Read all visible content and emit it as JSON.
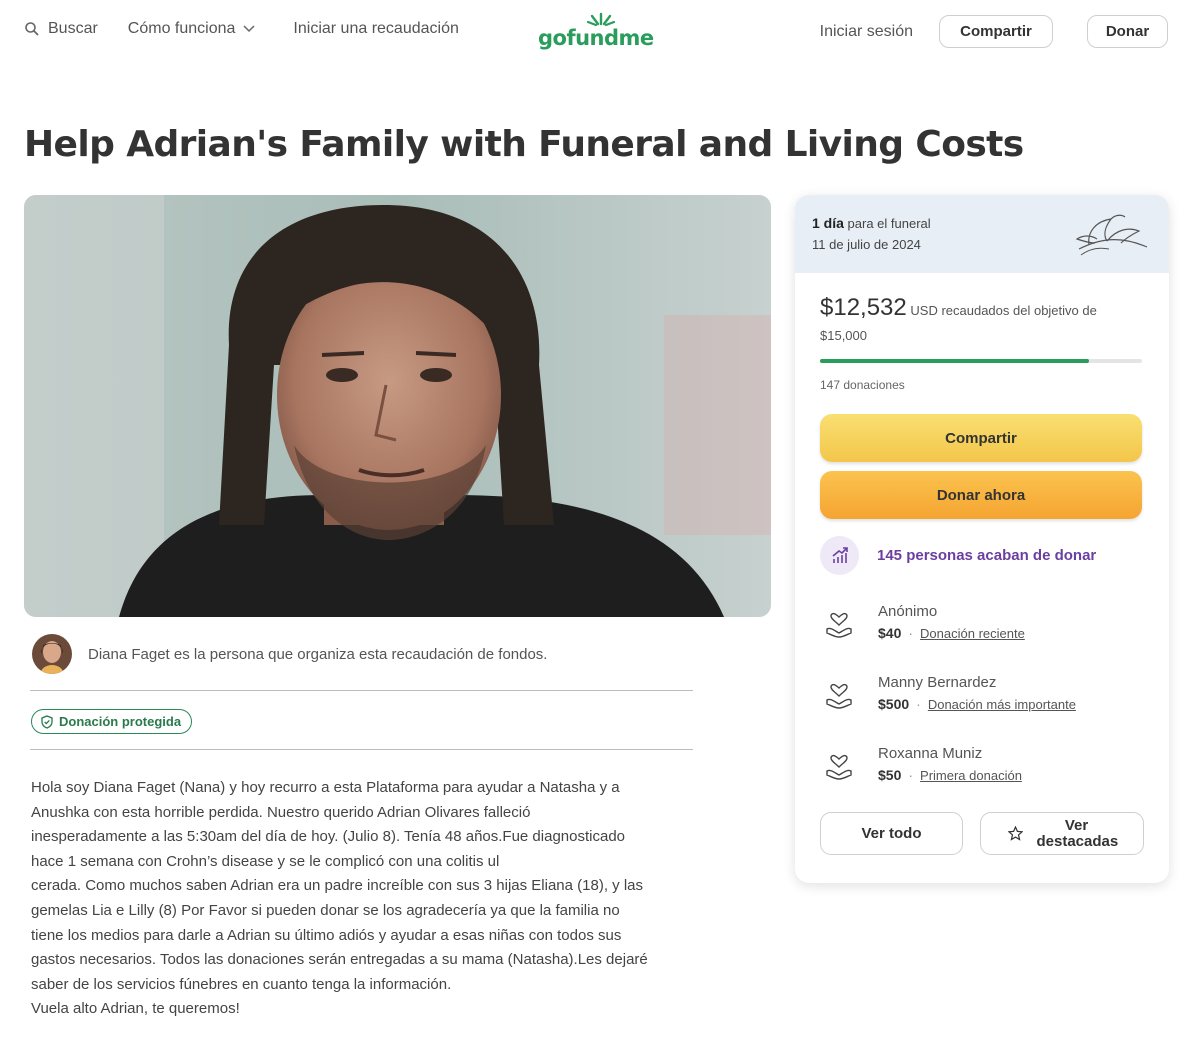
{
  "header": {
    "search_label": "Buscar",
    "how_it_works_label": "Cómo funciona",
    "start_label": "Iniciar una recaudación",
    "logo_text": "gofundme",
    "login_label": "Iniciar sesión",
    "share_label": "Compartir",
    "donate_label": "Donar"
  },
  "campaign": {
    "title": "Help Adrian's Family with Funeral and Living Costs",
    "organizer_text": "Diana Faget es la persona que organiza esta recaudación de fondos.",
    "protected_badge": "Donación protegida",
    "story_lines": [
      "Hola soy Diana Faget (Nana) y hoy recurro a esta Plataforma para ayudar a Natasha y a",
      "Anushka con esta horrible perdida. Nuestro querido Adrian Olivares falleció",
      "inesperadamente a las 5:30am del día de hoy. (Julio 8). Tenía 48 años.Fue diagnosticado",
      "hace 1 semana con Crohn’s disease y se le complicó con una colitis ul",
      "cerada. Como muchos saben Adrian era un padre increíble con sus 3 hijas Eliana (18), y las",
      "gemelas Lia e Lilly (8) Por Favor si pueden donar se los agradecería ya que la familia no",
      "tiene los medios para darle a Adrian su último adiós y ayudar a esas niñas con todos sus",
      "gastos necesarios. Todos las donaciones serán entregadas a su mama (Natasha).Les dejaré",
      "saber de los servicios fúnebres en cuanto tenga la información.",
      "Vuela alto Adrian, te queremos!"
    ]
  },
  "sidebar": {
    "days_value": "1 día",
    "days_suffix": "para el funeral",
    "funeral_date": "11 de julio de 2024",
    "raised_amount": "$12,532",
    "raised_text": "USD recaudados del objetivo de",
    "goal_amount": "$15,000",
    "progress_fraction": 0.8355,
    "donation_count": "147 donaciones",
    "share_button": "Compartir",
    "donate_button": "Donar ahora",
    "recent_donors_text": "145 personas acaban de donar",
    "donors": [
      {
        "name": "Anónimo",
        "amount": "$40",
        "tag": "Donación reciente"
      },
      {
        "name": "Manny Bernardez",
        "amount": "$500",
        "tag": "Donación más importante"
      },
      {
        "name": "Roxanna Muniz",
        "amount": "$50",
        "tag": "Primera donación"
      }
    ],
    "see_all_button": "Ver todo",
    "see_featured_line1": "Ver",
    "see_featured_line2": "destacadas"
  },
  "colors": {
    "brand_green": "#2a9d5c",
    "share_yellow": "#f3c64a",
    "donate_orange": "#f5a431",
    "recent_purple": "#6b3fa0"
  },
  "icons": [
    "search-icon",
    "chevron-down-icon",
    "logo-rays-icon",
    "flower-icon",
    "shield-icon",
    "trending-up-icon",
    "heart-hands-icon",
    "star-icon"
  ]
}
